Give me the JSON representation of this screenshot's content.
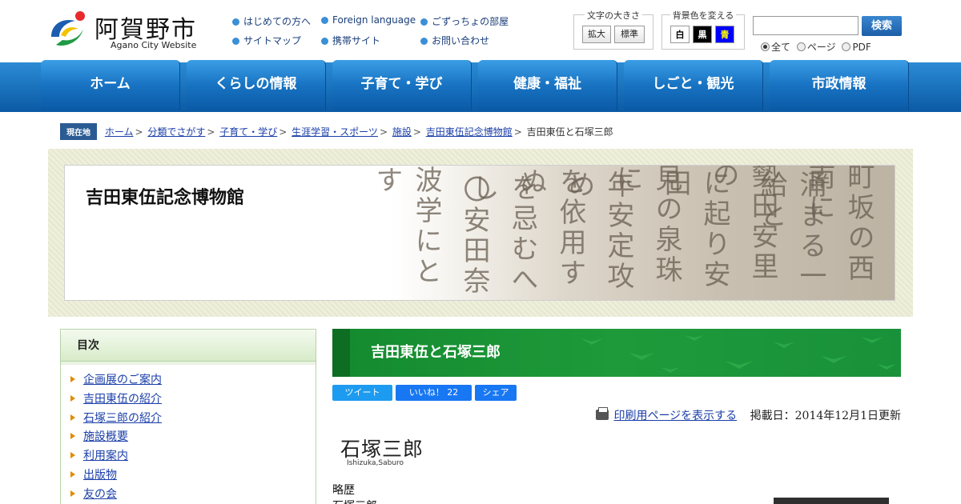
{
  "header": {
    "logo_title": "阿賀野市",
    "logo_subtitle": "Agano City Website",
    "links": [
      {
        "label": "はじめての方へ"
      },
      {
        "label": "Foreign language"
      },
      {
        "label": "ごずっちょの部屋"
      },
      {
        "label": "サイトマップ"
      },
      {
        "label": "携帯サイト"
      },
      {
        "label": "お問い合わせ"
      }
    ],
    "text_size": {
      "title": "文字の大きさ",
      "enlarge": "拡大",
      "standard": "標準"
    },
    "bg_color": {
      "title": "背景色を変える",
      "white": "白",
      "black": "黒",
      "blue": "青",
      "white_color": "#ffffff",
      "black_color": "#000000",
      "blue_color": "#0000ff",
      "blue_text_color": "#ffff00"
    },
    "search": {
      "button": "検索",
      "value": ""
    },
    "search_scope": {
      "all": "全て",
      "page": "ページ",
      "pdf": "PDF",
      "selected": "全て"
    }
  },
  "nav": [
    "ホーム",
    "くらしの情報",
    "子育て・学び",
    "健康・福祉",
    "しごと・観光",
    "市政情報"
  ],
  "breadcrumb": {
    "badge": "現在地",
    "links": [
      "ホーム",
      "分類でさがす",
      "子育て・学び",
      "生涯学習・スポーツ",
      "施設",
      "吉田東伍記念博物館"
    ],
    "current": "吉田東伍と石塚三郎"
  },
  "banner": {
    "title": "吉田東伍記念博物館"
  },
  "sidebar": {
    "title": "目次",
    "items": [
      "企画展のご案内",
      "吉田東伍の紹介",
      "石塚三郎の紹介",
      "施設概要",
      "利用案内",
      "出版物",
      "友の会"
    ]
  },
  "main": {
    "heading": "吉田東伍と石塚三郎",
    "share": {
      "tweet": "ツイート",
      "like": "いいね！ 22",
      "share": "シェア"
    },
    "print_link": "印刷用ページを表示する",
    "updated": "掲載日：2014年12月1日更新",
    "person_name": "石塚三郎",
    "person_roman": "Ishizuka,Saburo",
    "section_label": "略歴",
    "section_text": "石塚三郎"
  },
  "colors": {
    "nav": "#1a6fbf",
    "heading_green": "#1e9a3a",
    "link": "#1a3ea8",
    "toc_border": "#b6d3a8"
  }
}
